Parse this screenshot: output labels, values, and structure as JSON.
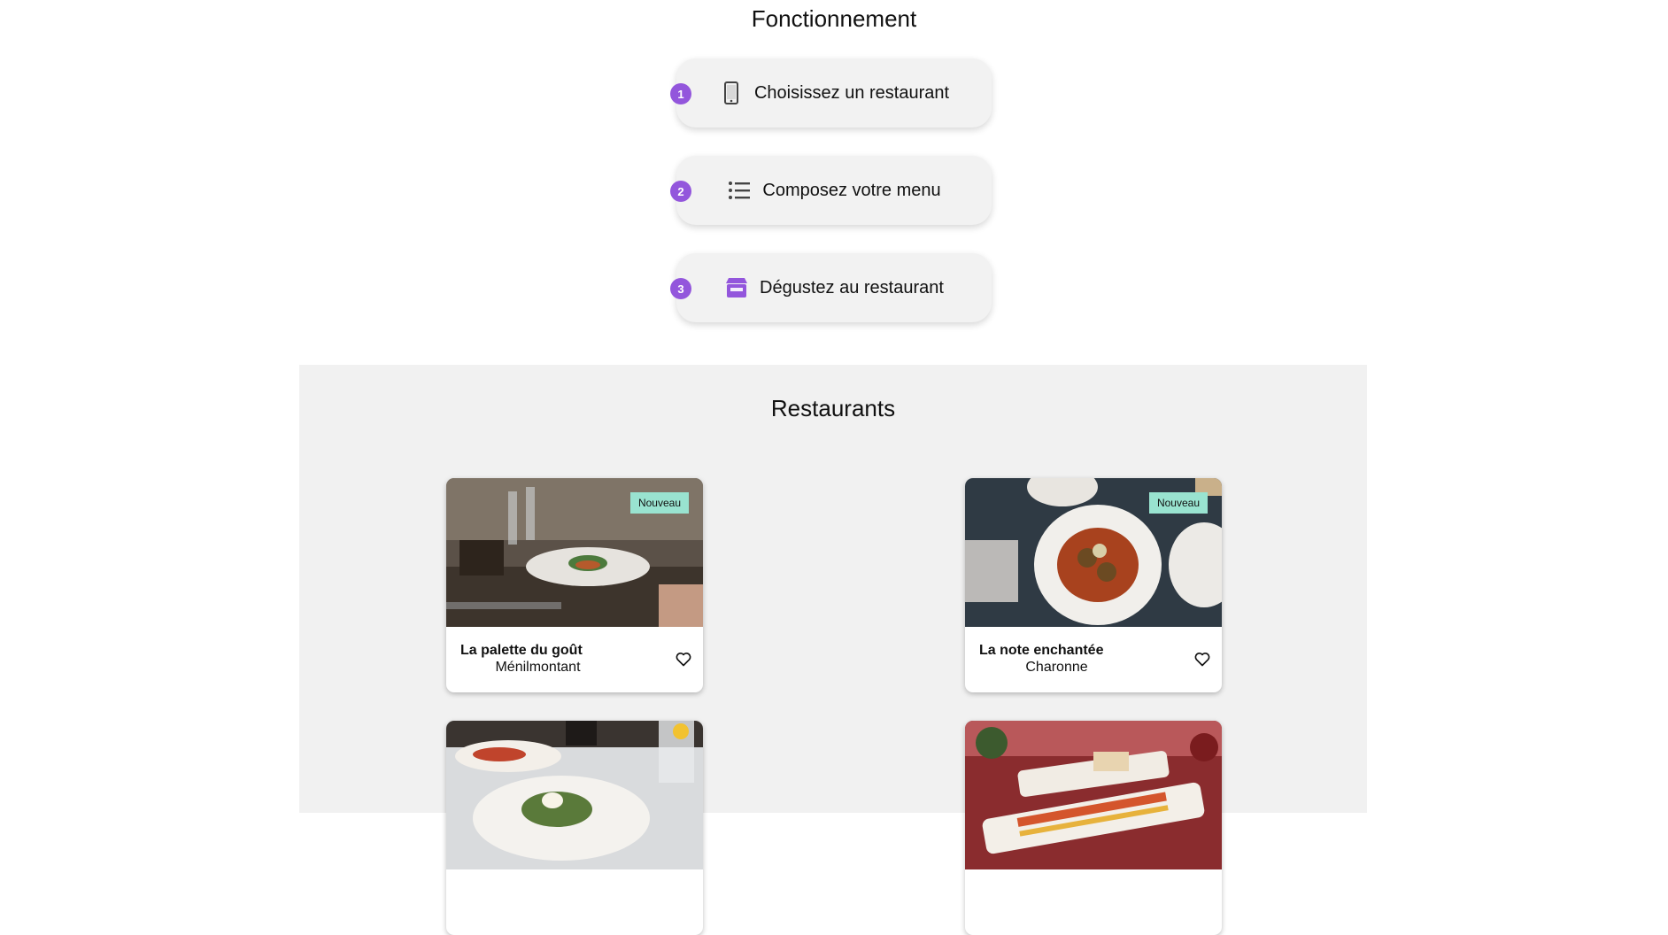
{
  "how_it_works": {
    "title": "Fonctionnement",
    "steps": [
      {
        "number": "1",
        "icon": "smartphone-icon",
        "label": "Choisissez un restaurant"
      },
      {
        "number": "2",
        "icon": "list-icon",
        "label": "Composez votre menu"
      },
      {
        "number": "3",
        "icon": "storefront-icon",
        "label": "Dégustez au restaurant"
      }
    ]
  },
  "restaurants": {
    "title": "Restaurants",
    "cards": [
      {
        "name": "La palette du goût",
        "area": "Ménilmontant",
        "badge": "Nouveau"
      },
      {
        "name": "La note enchantée",
        "area": "Charonne",
        "badge": "Nouveau"
      },
      {
        "name": "",
        "area": "",
        "badge": ""
      },
      {
        "name": "",
        "area": "",
        "badge": ""
      }
    ]
  },
  "colors": {
    "accent": "#9356dc",
    "badge_new": "#99e3d0",
    "section_bg": "#f1f1f1"
  }
}
